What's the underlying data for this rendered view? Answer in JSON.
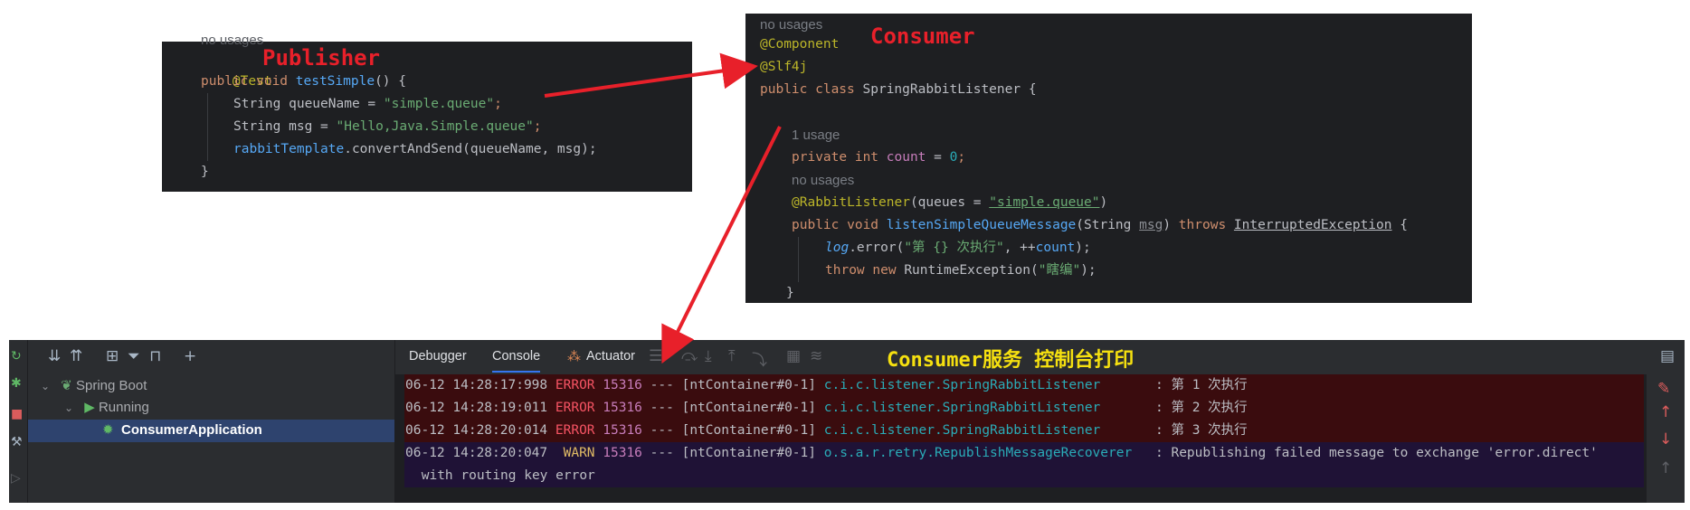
{
  "labels": {
    "publisher": "Publisher",
    "consumer": "Consumer",
    "console_print": "Consumer服务 控制台打印"
  },
  "publisher_code": {
    "usage_hint": "no usages",
    "annotation": "@Test",
    "l1_kw": "public void ",
    "l1_fn": "testSimple",
    "l1_rest": "() {",
    "l2_pre": "String queueName = ",
    "l2_str": "\"simple.queue\"",
    "l2_end": ";",
    "l3_pre": "String msg = ",
    "l3_str": "\"Hello,Java.Simple.queue\"",
    "l3_end": ";",
    "l4_field": "rabbitTemplate",
    "l4_rest": ".convertAndSend(queueName, msg);",
    "l5": "}"
  },
  "consumer_code": {
    "usage_hint_top": "no usages",
    "ann1": "@Component",
    "ann2": "@Slf4j",
    "class_kw": "public class ",
    "class_name": "SpringRabbitListener {",
    "usage_1": "1 usage",
    "f_kw": "private int ",
    "f_name": "count",
    "f_eq": " = ",
    "f_val": "0",
    "f_end": ";",
    "usage_none": "no usages",
    "rl_ann": "@RabbitListener",
    "rl_pre": "(queues = ",
    "rl_val": "\"simple.queue\"",
    "rl_end": ")",
    "m_kw": "public void ",
    "m_name": "listenSimpleQueueMessage",
    "m_p1": "(String ",
    "m_param": "msg",
    "m_p2": ") ",
    "m_throws": "throws ",
    "m_exc": "InterruptedException",
    "m_end": " {",
    "log": "log",
    "log_call": ".error(",
    "log_str": "\"第 {} 次执行\"",
    "log_mid": ", ++",
    "log_var": "count",
    "log_end": ");",
    "throw_kw": "throw new ",
    "throw_cls": "RuntimeException(",
    "throw_str": "\"瞎编\"",
    "throw_end": ");",
    "close": "}"
  },
  "ide": {
    "tabs": [
      "Debugger",
      "Console",
      "Actuator"
    ],
    "active_tab": "Console",
    "tree": {
      "root": "Spring Boot",
      "group": "Running",
      "app": "ConsumerApplication"
    },
    "icons": {
      "expand_all": "expand-all-icon",
      "collapse_all": "collapse-all-icon",
      "group": "group-icon",
      "filter": "filter-icon",
      "layout": "layout-icon",
      "add": "add-icon"
    },
    "logs": [
      {
        "time": "06-12 14:28:17:998",
        "level": "ERROR",
        "pid": "15316",
        "sep": "---",
        "thread": "[ntContainer#0-1]",
        "logger": "c.i.c.listener.SpringRabbitListener",
        "msg": ": 第 1 次执行"
      },
      {
        "time": "06-12 14:28:19:011",
        "level": "ERROR",
        "pid": "15316",
        "sep": "---",
        "thread": "[ntContainer#0-1]",
        "logger": "c.i.c.listener.SpringRabbitListener",
        "msg": ": 第 2 次执行"
      },
      {
        "time": "06-12 14:28:20:014",
        "level": "ERROR",
        "pid": "15316",
        "sep": "---",
        "thread": "[ntContainer#0-1]",
        "logger": "c.i.c.listener.SpringRabbitListener",
        "msg": ": 第 3 次执行"
      },
      {
        "time": "06-12 14:28:20:047",
        "level": "WARN",
        "pid": "15316",
        "sep": "---",
        "thread": "[ntContainer#0-1]",
        "logger": "o.s.a.r.retry.RepublishMessageRecoverer",
        "msg": ": Republishing failed message to exchange 'error.direct'"
      }
    ],
    "log_continuation": " with routing key error"
  },
  "colors": {
    "arrow": "#e8202a",
    "editor_bg": "#1e1f22",
    "error_row": "#3a0c0e",
    "warn_row": "#1f1236"
  }
}
